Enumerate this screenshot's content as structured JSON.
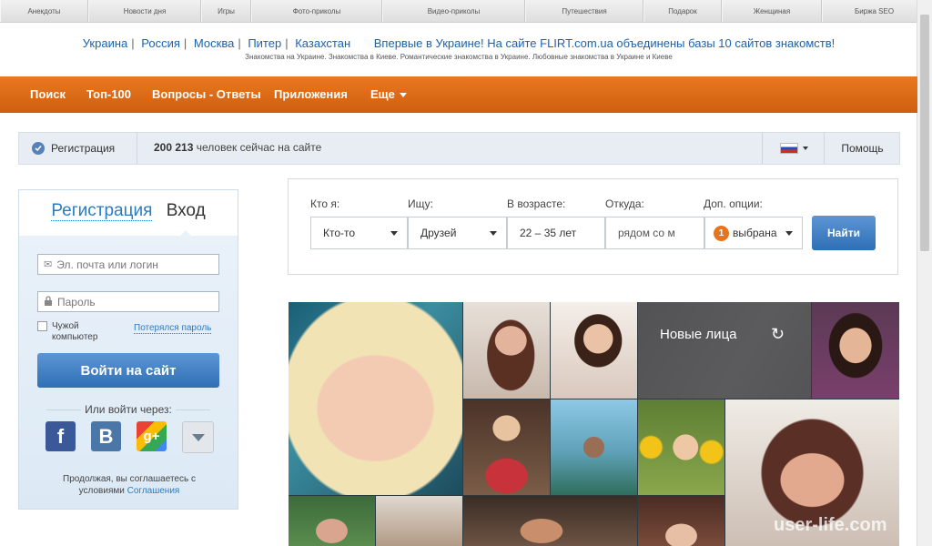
{
  "top_links": [
    "Анекдоты",
    "Новости дня",
    "Игры",
    "Фото-приколы",
    "Видео-приколы",
    "Путешествия",
    "Подарок",
    "Женщиная",
    "Биржа SEO"
  ],
  "header": {
    "countries": [
      "Украина",
      "Россия",
      "Москва",
      "Питер",
      "Казахстан"
    ],
    "promo": "Впервые в Украине! На сайте FLIRT.com.ua объединены базы 10 сайтов знакомств!",
    "subline": "Знакомства на Украине. Знакомства в Киеве. Романтические знакомства в Украине. Любовные знакомства в Украине и Киеве"
  },
  "nav": {
    "search": "Поиск",
    "top100": "Топ-100",
    "qa": "Вопросы - Ответы",
    "apps": "Приложения",
    "more": "Еще"
  },
  "status": {
    "registration": "Регистрация",
    "online_count": "200 213",
    "online_text": "человек сейчас на сайте",
    "help": "Помощь"
  },
  "login": {
    "tab_register": "Регистрация",
    "tab_login": "Вход",
    "email_placeholder": "Эл. почта или логин",
    "password_placeholder": "Пароль",
    "remember": "Чужой компьютер",
    "forgot": "Потерялся пароль",
    "submit": "Войти на сайт",
    "or_via": "Или войти через:",
    "social": [
      "f",
      "B",
      "g+"
    ],
    "terms_text": "Продолжая, вы соглашаетесь с условиями",
    "terms_link": "Соглашения"
  },
  "search": {
    "who_label": "Кто я:",
    "who_value": "Кто-то",
    "seek_label": "Ищу:",
    "seek_value": "Друзей",
    "age_label": "В возрасте:",
    "age_value": "22 – 35  лет",
    "from_label": "Откуда:",
    "from_value": "рядом со м",
    "options_label": "Доп. опции:",
    "options_count": "1",
    "options_value": "выбрана",
    "find_button": "Найти"
  },
  "new_faces": "Новые лица",
  "watermark": "user-life.com",
  "colors": {
    "nav_orange": "#e06a16",
    "link_blue": "#2a7bc6",
    "button_blue": "#3f7fc2",
    "badge_orange": "#e8741d"
  }
}
